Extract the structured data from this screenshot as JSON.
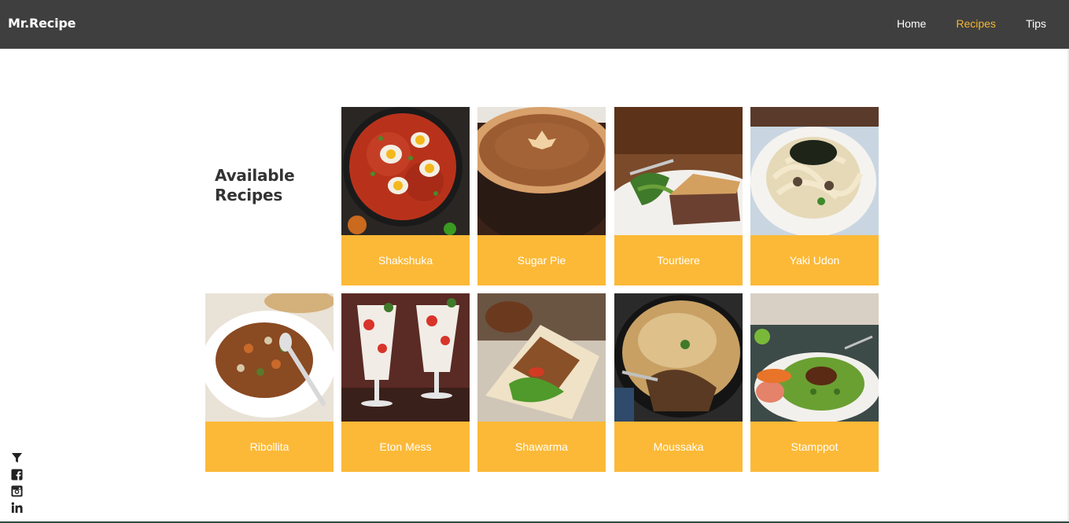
{
  "brand": "Mr.Recipe",
  "nav": {
    "home": "Home",
    "recipes": "Recipes",
    "tips": "Tips"
  },
  "heading": {
    "line1": "Available",
    "line2": "Recipes"
  },
  "recipes": [
    "Shakshuka",
    "Sugar Pie",
    "Tourtiere",
    "Yaki Udon",
    "Ribollita",
    "Eton Mess",
    "Shawarma",
    "Moussaka",
    "Stamppot"
  ],
  "colors": {
    "navbar": "#3f3f3f",
    "accent": "#f5b731",
    "card_label": "#fcb937"
  },
  "social_icons": [
    "filter-icon",
    "facebook-icon",
    "instagram-icon",
    "linkedin-icon"
  ]
}
